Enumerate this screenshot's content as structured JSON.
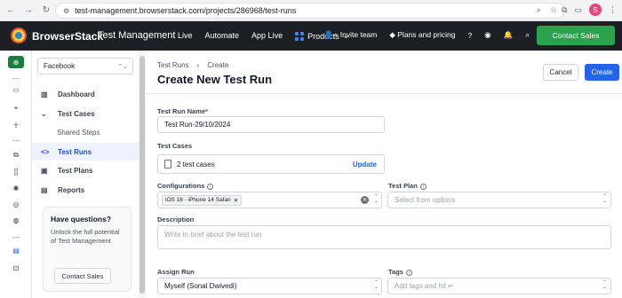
{
  "browser": {
    "url": "test-management.browserstack.com/projects/286968/test-runs",
    "profile_initial": "S"
  },
  "topbar": {
    "brand": "BrowserStack",
    "product": "Test Management",
    "nav": [
      "Live",
      "Automate",
      "App Live",
      "Products"
    ],
    "invite": "Invite team",
    "plans": "Plans and pricing",
    "contact_sales": "Contact Sales"
  },
  "sidebar": {
    "project": "Facebook",
    "items": [
      {
        "label": "Dashboard",
        "icon": "bar-chart-icon"
      },
      {
        "label": "Test Cases",
        "icon": "chevron-down-icon"
      },
      {
        "label": "Shared Steps",
        "icon": ""
      },
      {
        "label": "Test Runs",
        "icon": "code-icon"
      },
      {
        "label": "Test Plans",
        "icon": "clipboard-icon"
      },
      {
        "label": "Reports",
        "icon": "report-icon"
      }
    ],
    "help": {
      "title": "Have questions?",
      "body": "Unlock the full potential of Test Management",
      "button": "Contact Sales"
    }
  },
  "main": {
    "breadcrumb": [
      "Test Runs",
      "Create"
    ],
    "title": "Create New Test Run",
    "cancel": "Cancel",
    "create": "Create",
    "form": {
      "name_label": "Test Run Name",
      "name_value": "Test Run-29/10/2024",
      "cases_label": "Test Cases",
      "cases_value": "2 test cases",
      "cases_update": "Update",
      "config_label": "Configurations",
      "config_chip": "iOS 16 - iPhone 14 Safari",
      "plan_label": "Test Plan",
      "plan_placeholder": "Select from options",
      "desc_label": "Description",
      "desc_placeholder": "Write in brief about the test run",
      "assign_label": "Assign Run",
      "assign_value": "Myself (Sonal Dwivedi)",
      "tags_label": "Tags",
      "tags_placeholder": "Add tags and hit ↵"
    }
  },
  "colors": {
    "primary": "#2563eb",
    "contact_green": "#2ba24c",
    "topbar_bg": "#1c1f24"
  }
}
